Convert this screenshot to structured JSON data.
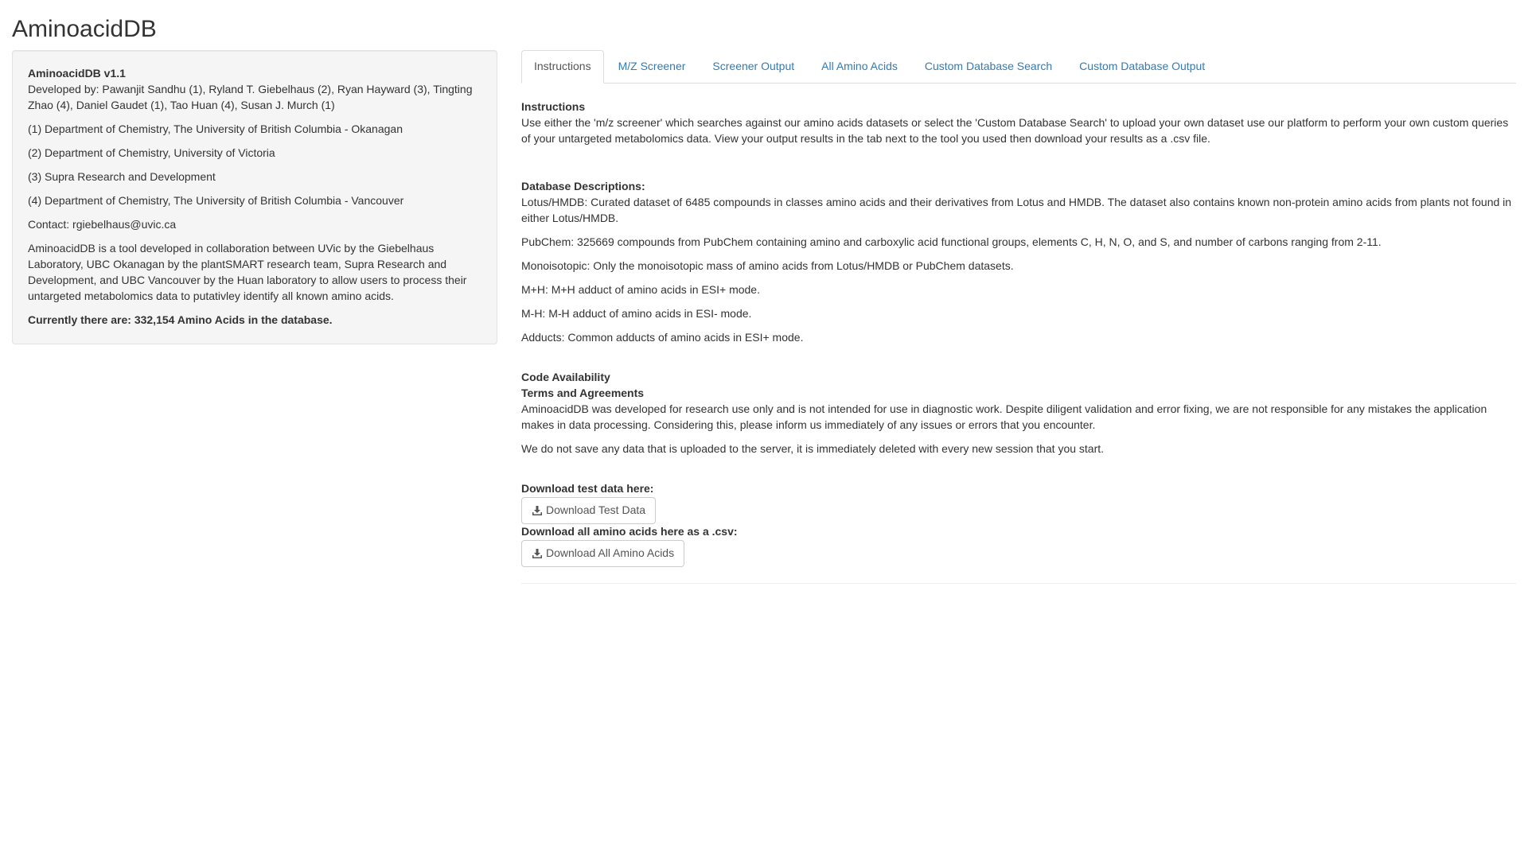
{
  "app": {
    "title": "AminoacidDB"
  },
  "sidebar": {
    "version": "AminoacidDB v1.1",
    "developers": "Developed by: Pawanjit Sandhu (1), Ryland T. Giebelhaus (2), Ryan Hayward (3), Tingting Zhao (4), Daniel Gaudet (1), Tao Huan (4), Susan J. Murch (1)",
    "affiliations": [
      "(1) Department of Chemistry, The University of British Columbia - Okanagan",
      "(2) Department of Chemistry, University of Victoria",
      "(3) Supra Research and Development",
      "(4) Department of Chemistry, The University of British Columbia - Vancouver"
    ],
    "contact": "Contact: rgiebelhaus@uvic.ca",
    "description": "AminoacidDB is a tool developed in collaboration between UVic by the Giebelhaus Laboratory, UBC Okanagan by the plantSMART research team, Supra Research and Development, and UBC Vancouver by the Huan laboratory to allow users to process their untargeted metabolomics data to putativley identify all known amino acids.",
    "count": "Currently there are: 332,154 Amino Acids in the database."
  },
  "tabs": [
    {
      "label": "Instructions",
      "active": true
    },
    {
      "label": "M/Z Screener",
      "active": false
    },
    {
      "label": "Screener Output",
      "active": false
    },
    {
      "label": "All Amino Acids",
      "active": false
    },
    {
      "label": "Custom Database Search",
      "active": false
    },
    {
      "label": "Custom Database Output",
      "active": false
    }
  ],
  "instructions": {
    "heading": "Instructions",
    "text": "Use either the 'm/z screener' which searches against our amino acids datasets or select the 'Custom Database Search' to upload your own dataset use our platform to perform your own custom queries of your untargeted metabolomics data. View your output results in the tab next to the tool you used then download your results as a .csv file."
  },
  "databases": {
    "heading": "Database Descriptions:",
    "items": [
      "Lotus/HMDB: Curated dataset of 6485 compounds in classes amino acids and their derivatives from Lotus and HMDB. The dataset also contains known non-protein amino acids from plants not found in either Lotus/HMDB.",
      "PubChem: 325669 compounds from PubChem containing amino and carboxylic acid functional groups, elements C, H, N, O, and S, and number of carbons ranging from 2-11.",
      "Monoisotopic: Only the monoisotopic mass of amino acids from Lotus/HMDB or PubChem datasets.",
      "M+H: M+H adduct of amino acids in ESI+ mode.",
      "M-H: M-H adduct of amino acids in ESI- mode.",
      "Adducts: Common adducts of amino acids in ESI+ mode."
    ]
  },
  "code": {
    "heading": "Code Availability"
  },
  "terms": {
    "heading": "Terms and Agreements",
    "text1": "AminoacidDB was developed for research use only and is not intended for use in diagnostic work. Despite diligent validation and error fixing, we are not responsible for any mistakes the application makes in data processing. Considering this, please inform us immediately of any issues or errors that you encounter.",
    "text2": "We do not save any data that is uploaded to the server, it is immediately deleted with every new session that you start."
  },
  "downloads": {
    "test_label": "Download test data here:",
    "test_button": "Download Test Data",
    "all_label": "Download all amino acids here as a .csv:",
    "all_button": "Download All Amino Acids"
  },
  "colors": {
    "link": "#337ab7",
    "well_bg": "#f5f5f5",
    "text": "#333333"
  },
  "icons": {
    "download": "download-icon"
  }
}
